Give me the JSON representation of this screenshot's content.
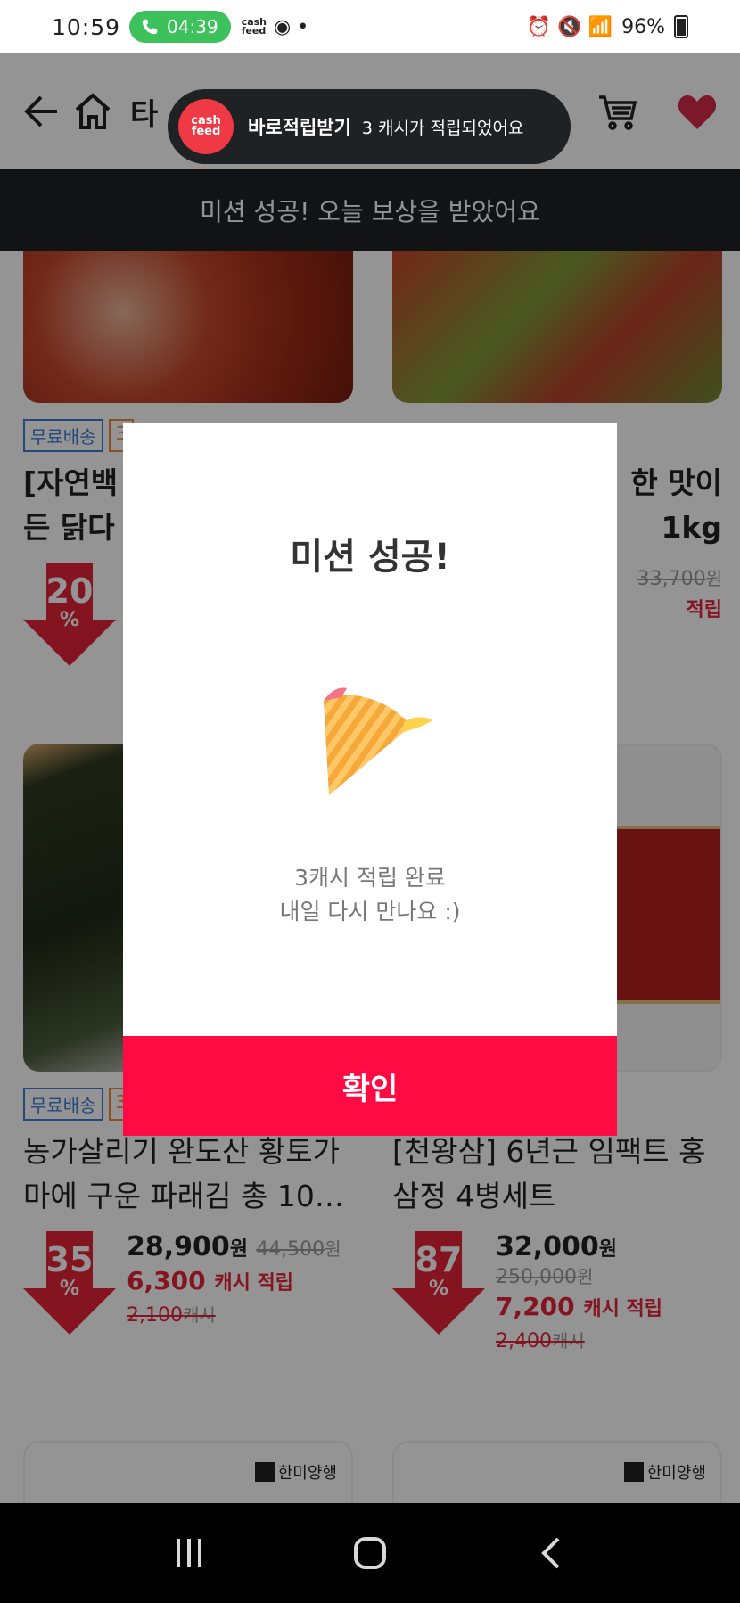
{
  "status_bar": {
    "time": "10:59",
    "call_timer": "04:39",
    "mini_app_line1": "cash",
    "mini_app_line2": "feed",
    "battery": "96%"
  },
  "header": {
    "title": "타"
  },
  "banner": {
    "text": "미션 성공! 오늘 보상을 받았어요"
  },
  "toast": {
    "logo_line1": "cash",
    "logo_line2": "feed",
    "title": "바로적립받기",
    "message": "3 캐시가 적립되었어요"
  },
  "products": [
    {
      "tags": [
        "무료배송",
        "3"
      ],
      "name_line1": "[자연백",
      "name_line2": "든 닭다",
      "discount": "20",
      "percent_sign": "%"
    },
    {
      "name_line1": "한 맛이",
      "name_line2": "1kg",
      "orig_price": "33,700",
      "orig_unit": "원",
      "cash_fragment": "적립"
    },
    {
      "tags": [
        "무료배송",
        "3"
      ],
      "name_line1": "농가살리기 완도산 황토가",
      "name_line2": "마에 구운 파래김 총 10…",
      "discount": "35",
      "percent_sign": "%",
      "price": "28,900",
      "price_unit": "원",
      "orig_price": "44,500",
      "orig_unit": "원",
      "cash": "6,300",
      "cash_unit": "캐시 적립",
      "old_cash": "2,100",
      "old_cash_unit": "캐시"
    },
    {
      "name_line1": "[천왕삼] 6년근 임팩트 홍",
      "name_line2": "삼정 4병세트",
      "discount": "87",
      "percent_sign": "%",
      "price": "32,000",
      "price_unit": "원",
      "orig_price": "250,000",
      "orig_unit": "원",
      "cash": "7,200",
      "cash_unit": "캐시 적립",
      "old_cash": "2,400",
      "old_cash_unit": "캐시"
    }
  ],
  "brand": "한미양행",
  "modal": {
    "title": "미션 성공!",
    "message_line1": "3캐시 적립 완료",
    "message_line2": "내일 다시 만나요 :)",
    "confirm_label": "확인",
    "confirm_color": "#ff0a43"
  },
  "icons": [
    "phone-icon",
    "back-arrow-icon",
    "home-icon",
    "search-icon",
    "cart-icon",
    "heart-icon",
    "party-popper-icon",
    "recent-apps-icon",
    "home-nav-icon",
    "back-nav-icon"
  ]
}
